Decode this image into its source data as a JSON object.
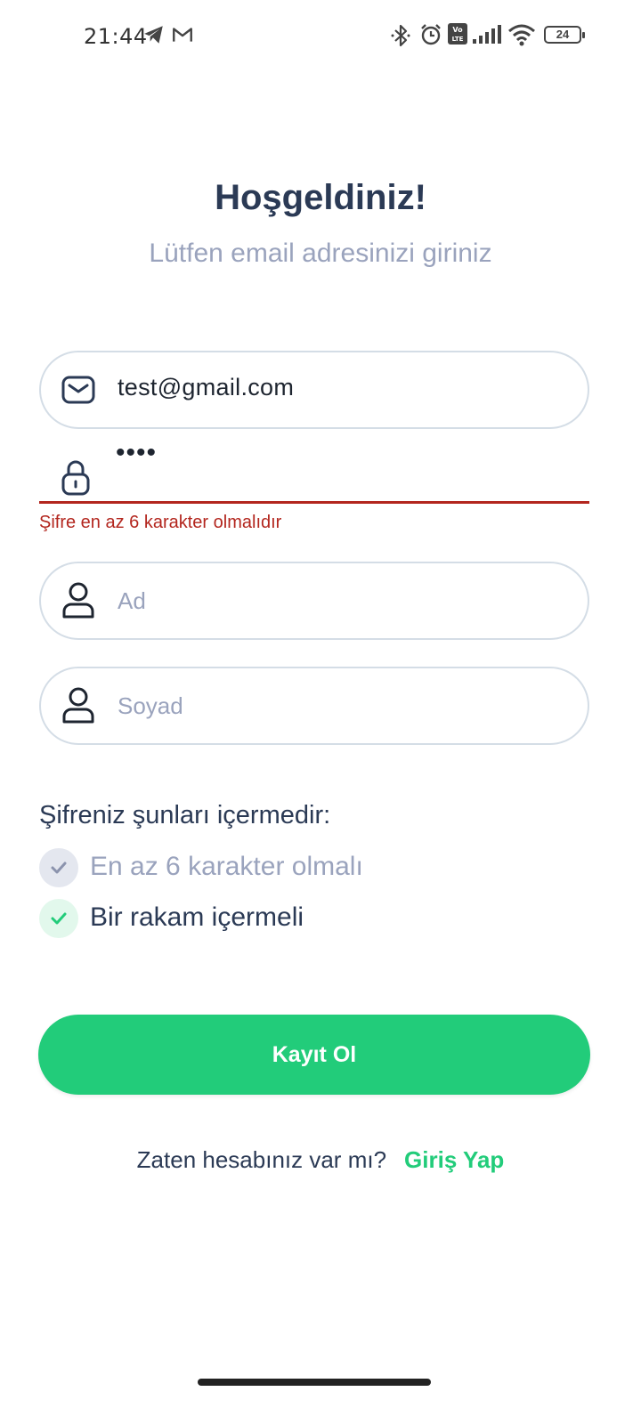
{
  "status_bar": {
    "time": "21:44",
    "battery_level": "24",
    "icons": [
      "telegram-icon",
      "gmail-icon",
      "bluetooth-icon",
      "alarm-icon",
      "volte-icon",
      "signal-icon",
      "wifi-icon",
      "battery-icon"
    ]
  },
  "header": {
    "title": "Hoşgeldiniz!",
    "subtitle": "Lütfen email adresinizi giriniz"
  },
  "form": {
    "email": {
      "value": "test@gmail.com",
      "icon": "mail-icon"
    },
    "password": {
      "value": "••••",
      "icon": "lock-icon",
      "error": "Şifre en az 6 karakter olmalıdır"
    },
    "first_name": {
      "placeholder": "Ad",
      "icon": "user-icon"
    },
    "last_name": {
      "placeholder": "Soyad",
      "icon": "user-icon"
    }
  },
  "requirements": {
    "title": "Şifreniz şunları içermedir:",
    "items": [
      {
        "label": "En az 6 karakter olmalı",
        "met": false
      },
      {
        "label": "Bir rakam içermeli",
        "met": true
      }
    ]
  },
  "actions": {
    "submit_label": "Kayıt Ol",
    "login_question": "Zaten hesabınız var mı?",
    "login_link": "Giriş Yap"
  },
  "colors": {
    "accent": "#22cc7a",
    "error": "#b3261e",
    "text_primary": "#2b3a55",
    "text_muted": "#9aa3bd",
    "border": "#d4dde6"
  }
}
